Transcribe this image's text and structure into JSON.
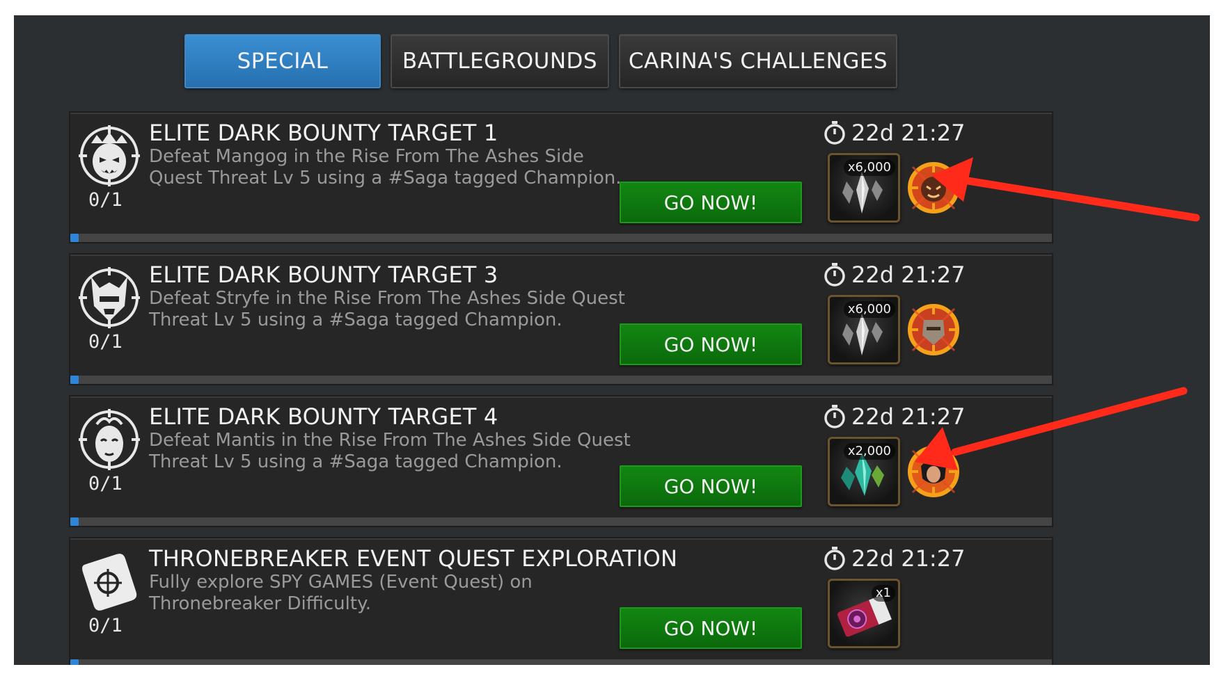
{
  "tabs": [
    {
      "label": "SPECIAL",
      "active": true
    },
    {
      "label": "BATTLEGROUNDS",
      "active": false
    },
    {
      "label": "CARINA'S CHALLENGES",
      "active": false
    }
  ],
  "quests": [
    {
      "title": "ELITE DARK BOUNTY TARGET 1",
      "description": "Defeat Mangog in the Rise From The Ashes Side Quest Threat Lv 5 using a #Saga tagged Champion.",
      "progress_text": "0/1",
      "progress": 0,
      "button_label": "GO NOW!",
      "timer": "22d 21:27",
      "reward_count": "x6,000",
      "reward_icon": "grey-shards-icon",
      "target_icon": "mangog-target-icon"
    },
    {
      "title": "ELITE DARK BOUNTY TARGET 3",
      "description": "Defeat Stryfe in the Rise From The Ashes Side Quest Threat Lv 5 using a #Saga tagged Champion.",
      "progress_text": "0/1",
      "progress": 0,
      "button_label": "GO NOW!",
      "timer": "22d 21:27",
      "reward_count": "x6,000",
      "reward_icon": "grey-shards-icon",
      "target_icon": "stryfe-target-icon"
    },
    {
      "title": "ELITE DARK BOUNTY TARGET 4",
      "description": "Defeat Mantis in the Rise From The Ashes Side Quest Threat Lv 5 using a #Saga tagged Champion.",
      "progress_text": "0/1",
      "progress": 0,
      "button_label": "GO NOW!",
      "timer": "22d 21:27",
      "reward_count": "x2,000",
      "reward_icon": "teal-shards-icon",
      "target_icon": "mantis-target-icon"
    },
    {
      "title": "THRONEBREAKER EVENT QUEST EXPLORATION",
      "description": "Fully explore SPY GAMES (Event Quest) on Thronebreaker Difficulty.",
      "progress_text": "0/1",
      "progress": 0,
      "button_label": "GO NOW!",
      "timer": "22d 21:27",
      "reward_count": "x1",
      "reward_icon": "ticket-icon",
      "target_icon": null
    }
  ],
  "colors": {
    "active_tab": "#2f7fc4",
    "go_button": "#0e7a0e",
    "progress_fill": "#2f86d8",
    "annotation_arrow": "#ff2a1a"
  }
}
